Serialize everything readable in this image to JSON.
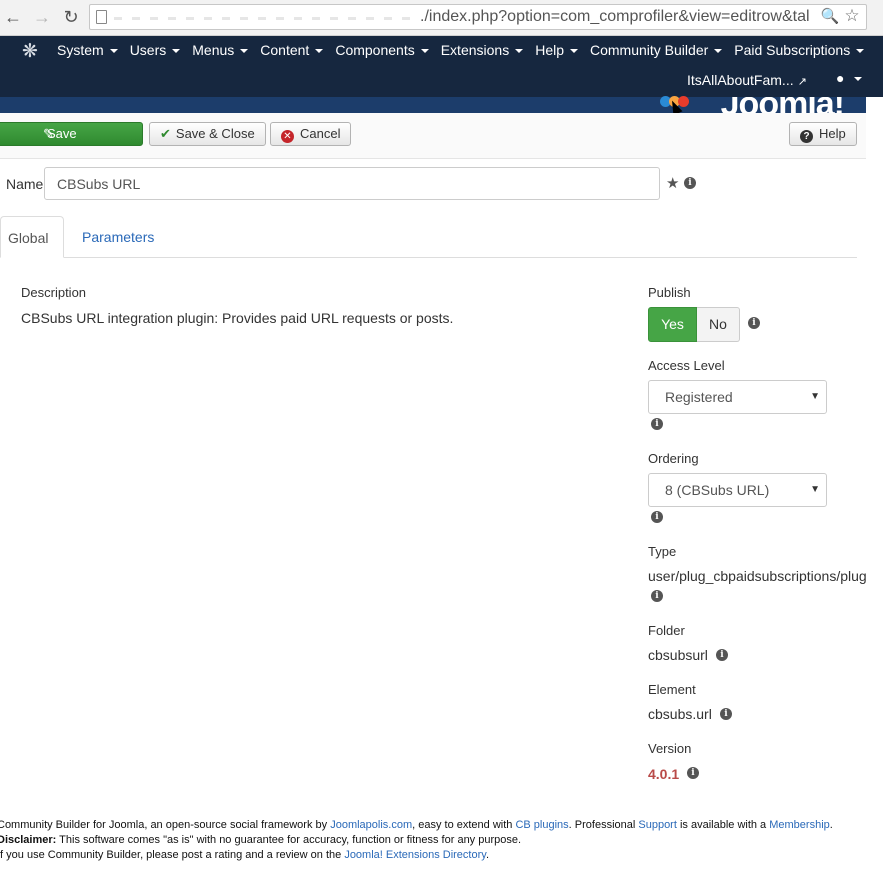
{
  "browser": {
    "url": "./index.php?option=com_comprofiler&view=editrow&tal"
  },
  "navbar": {
    "menus": [
      "System",
      "Users",
      "Menus",
      "Content",
      "Components",
      "Extensions",
      "Help",
      "Community Builder",
      "Paid Subscriptions"
    ],
    "site_link": "ItsAllAboutFam...",
    "brand": "Joomla!"
  },
  "toolbar": {
    "save": "Save",
    "save_close": "Save & Close",
    "cancel": "Cancel",
    "help": "Help"
  },
  "form": {
    "name_label": "Name",
    "name_value": "CBSubs URL",
    "tabs": [
      "Global",
      "Parameters"
    ],
    "description_label": "Description",
    "description_text": "CBSubs URL integration plugin: Provides paid URL requests or posts."
  },
  "details": {
    "publish_label": "Publish",
    "publish_yes": "Yes",
    "publish_no": "No",
    "access_label": "Access Level",
    "access_value": "Registered",
    "ordering_label": "Ordering",
    "ordering_value": "8 (CBSubs URL)",
    "type_label": "Type",
    "type_value": "user/plug_cbpaidsubscriptions/plugin",
    "folder_label": "Folder",
    "folder_value": "cbsubsurl",
    "element_label": "Element",
    "element_value": "cbsubs.url",
    "version_label": "Version",
    "version_value": "4.0.1"
  },
  "footer": {
    "line1_a": "Community Builder for Joomla, an open-source social framework by ",
    "link_joomlapolis": "Joomlapolis.com",
    "line1_b": ", easy to extend with ",
    "link_cbplugins": "CB plugins",
    "line1_c": ". Professional ",
    "link_support": "Support",
    "line1_d": " is available with a ",
    "link_membership": "Membership",
    "line1_e": ".",
    "disclaimer_label": "Disclaimer:",
    "disclaimer_text": " This software comes \"as is\" with no guarantee for accuracy, function or fitness for any purpose.",
    "line3_a": "If you use Community Builder, please post a rating and a review on the ",
    "link_jed": "Joomla! Extensions Directory",
    "line3_b": "."
  },
  "colors": {
    "navbar_bg": "#16273f",
    "save_green": "#46a546",
    "link_blue": "#2a69b8",
    "version_red": "#b94a48"
  }
}
